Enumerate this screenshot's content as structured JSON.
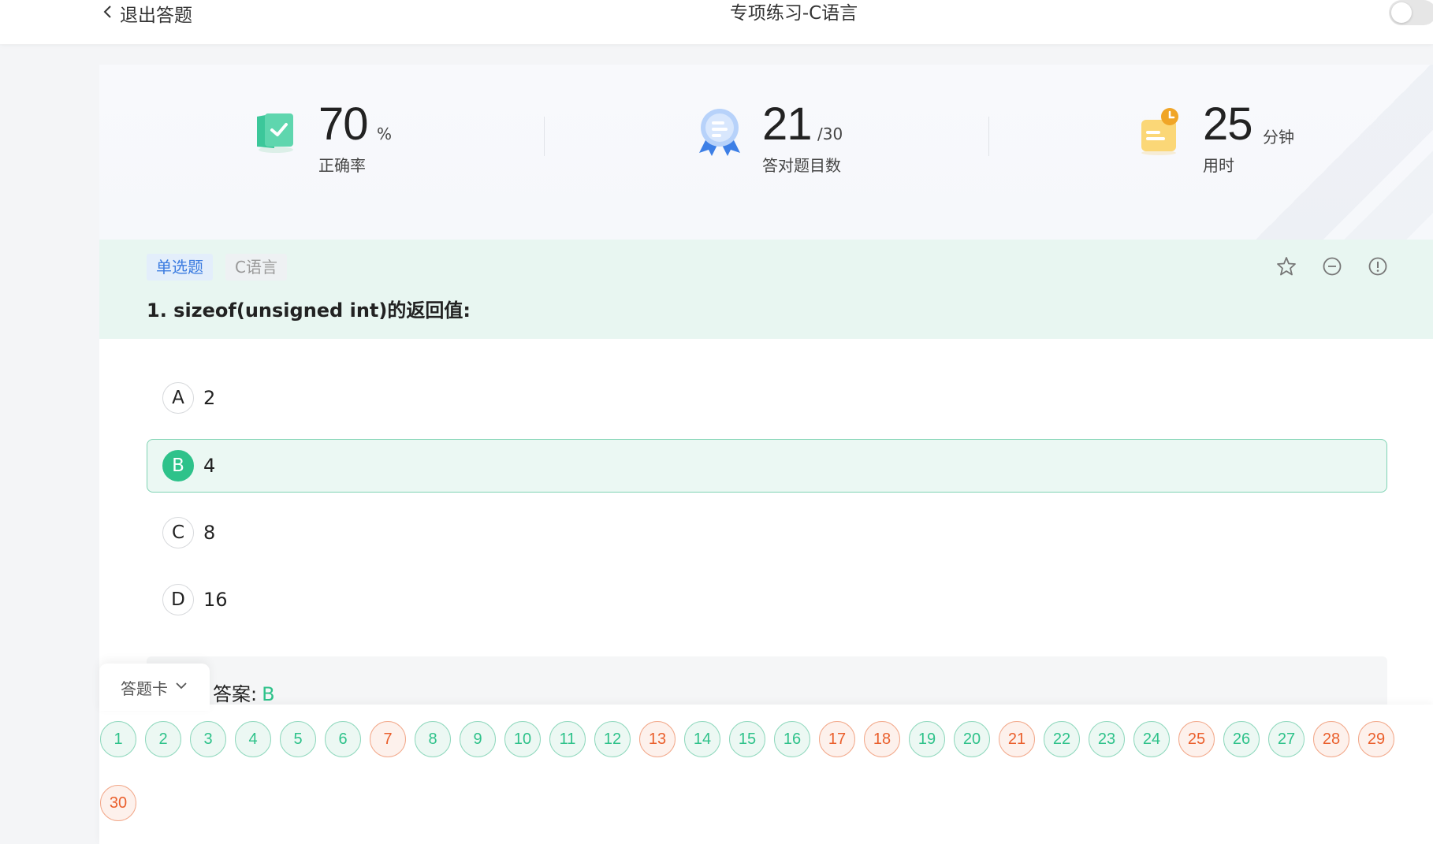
{
  "header": {
    "back_label": "退出答题",
    "title": "专项练习-C语言"
  },
  "stats": {
    "accuracy": {
      "value": "70",
      "unit": "%",
      "label": "正确率"
    },
    "correct": {
      "value": "21",
      "unit": "/30",
      "label": "答对题目数"
    },
    "time": {
      "value": "25",
      "unit": "分钟",
      "label": "用时"
    }
  },
  "question": {
    "type_tag": "单选题",
    "subject_tag": "C语言",
    "text": "1. sizeof(unsigned int)的返回值:",
    "options": [
      {
        "letter": "A",
        "text": "2",
        "selected": false
      },
      {
        "letter": "B",
        "text": "4",
        "selected": true
      },
      {
        "letter": "C",
        "text": "8",
        "selected": false
      },
      {
        "letter": "D",
        "text": "16",
        "selected": false
      }
    ],
    "answer_label": "答案:",
    "answer_value": "B"
  },
  "answer_card": {
    "tab_label": "答题卡",
    "items": [
      {
        "n": "1",
        "status": "correct"
      },
      {
        "n": "2",
        "status": "correct"
      },
      {
        "n": "3",
        "status": "correct"
      },
      {
        "n": "4",
        "status": "correct"
      },
      {
        "n": "5",
        "status": "correct"
      },
      {
        "n": "6",
        "status": "correct"
      },
      {
        "n": "7",
        "status": "wrong"
      },
      {
        "n": "8",
        "status": "correct"
      },
      {
        "n": "9",
        "status": "correct"
      },
      {
        "n": "10",
        "status": "correct"
      },
      {
        "n": "11",
        "status": "correct"
      },
      {
        "n": "12",
        "status": "correct"
      },
      {
        "n": "13",
        "status": "wrong"
      },
      {
        "n": "14",
        "status": "correct"
      },
      {
        "n": "15",
        "status": "correct"
      },
      {
        "n": "16",
        "status": "correct"
      },
      {
        "n": "17",
        "status": "wrong"
      },
      {
        "n": "18",
        "status": "wrong"
      },
      {
        "n": "19",
        "status": "correct"
      },
      {
        "n": "20",
        "status": "correct"
      },
      {
        "n": "21",
        "status": "wrong"
      },
      {
        "n": "22",
        "status": "correct"
      },
      {
        "n": "23",
        "status": "correct"
      },
      {
        "n": "24",
        "status": "correct"
      },
      {
        "n": "25",
        "status": "wrong"
      },
      {
        "n": "26",
        "status": "correct"
      },
      {
        "n": "27",
        "status": "correct"
      },
      {
        "n": "28",
        "status": "wrong"
      },
      {
        "n": "29",
        "status": "wrong"
      },
      {
        "n": "30",
        "status": "wrong"
      }
    ]
  },
  "colors": {
    "accent_green": "#2ec28a",
    "wrong_orange": "#ea5f2c",
    "tag_blue": "#3a7be0",
    "question_band": "#e8f6f1"
  },
  "icons": {
    "back": "chevron-left-icon",
    "accuracy": "check-book-icon",
    "correct_count": "award-badge-icon",
    "time": "clock-note-icon",
    "favorite": "star-icon",
    "remove": "minus-circle-icon",
    "report": "exclamation-circle-icon",
    "card_toggle": "chevron-down-icon"
  }
}
